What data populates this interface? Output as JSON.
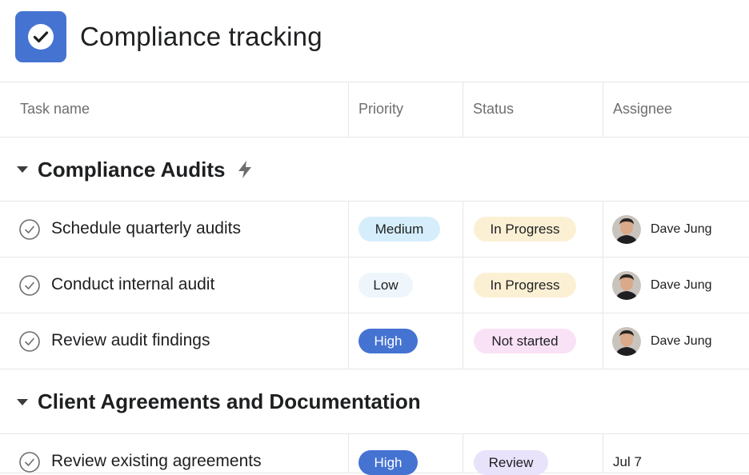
{
  "header": {
    "title": "Compliance tracking",
    "icon": "check-circle-icon",
    "accent": "#4573d2"
  },
  "columns": [
    "Task name",
    "Priority",
    "Status",
    "Assignee"
  ],
  "sections": [
    {
      "title": "Compliance Audits",
      "rows": [
        {
          "task": "Schedule quarterly audits",
          "priority": "Medium",
          "status": "In Progress",
          "assignee": "Dave Jung"
        },
        {
          "task": "Conduct internal audit",
          "priority": "Low",
          "status": "In Progress",
          "assignee": "Dave Jung"
        },
        {
          "task": "Review audit findings",
          "priority": "High",
          "status": "Not started",
          "assignee": "Dave Jung"
        }
      ]
    },
    {
      "title": "Client Agreements and Documentation",
      "rows": [
        {
          "task": "Review existing agreements",
          "priority": "High",
          "status": "Review",
          "due": "Jul 7"
        }
      ]
    }
  ],
  "colors": {
    "medium": "#d6eefb",
    "low": "#eef6fb",
    "high": "#4573d2",
    "in_progress": "#fcf0d4",
    "not_started": "#f9e2f6",
    "review": "#e8e2fb"
  }
}
